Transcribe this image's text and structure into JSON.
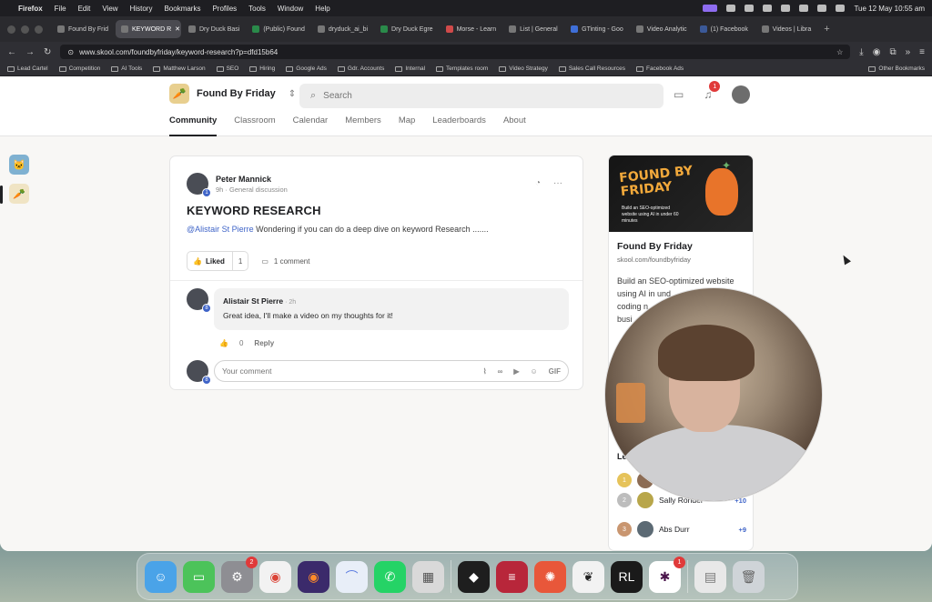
{
  "menubar": {
    "app": "Firefox",
    "items": [
      "File",
      "Edit",
      "View",
      "History",
      "Bookmarks",
      "Profiles",
      "Tools",
      "Window",
      "Help"
    ],
    "datetime": "Tue 12 May 10:55 am"
  },
  "tabs": [
    {
      "label": "Found By Frid"
    },
    {
      "label": "KEYWORD R",
      "active": true
    },
    {
      "label": "Dry Duck Basi"
    },
    {
      "label": "(Public) Found"
    },
    {
      "label": "dryduck_ai_bi"
    },
    {
      "label": "Dry Duck Egre"
    },
    {
      "label": "Morse - Learn"
    },
    {
      "label": "List | General"
    },
    {
      "label": "GTinting - Goo"
    },
    {
      "label": "Video Analytic"
    },
    {
      "label": "(1) Facebook"
    },
    {
      "label": "Videos | Libra"
    }
  ],
  "url": "www.skool.com/foundbyfriday/keyword-research?p=dfd15b64",
  "bookmarks": [
    "Lead Cartel",
    "Competition",
    "AI Tools",
    "Matthew Larson",
    "SEO",
    "Hiring",
    "Google Ads",
    "Gdr. Accounts",
    "Internal",
    "Templates room",
    "Video Strategy",
    "Sales Call Resources",
    "Facebook Ads",
    "Other Bookmarks"
  ],
  "skool": {
    "group_name": "Found By Friday",
    "search_placeholder": "Search",
    "notification_count": "1",
    "nav": [
      "Community",
      "Classroom",
      "Calendar",
      "Members",
      "Map",
      "Leaderboards",
      "About"
    ],
    "active_nav": "Community"
  },
  "post": {
    "author": "Peter Mannick",
    "author_level": "1",
    "meta": "9h · General discussion",
    "title": "KEYWORD RESEARCH",
    "mention": "@Alistair St Pierre",
    "body": " Wondering if you can do a deep dive on keyword Research .......",
    "like_label": "Liked",
    "like_count": "1",
    "comment_count": "1 comment"
  },
  "comment": {
    "author": "Alistair St Pierre",
    "author_level": "8",
    "time": " · 2h",
    "text": "Great idea, I'll make a video on my thoughts for it!",
    "likes": "0",
    "reply": "Reply",
    "input_placeholder": "Your comment",
    "gif_label": "GIF"
  },
  "sidebar": {
    "banner_title_1": "FOUND BY",
    "banner_title_2": "FRIDAY",
    "banner_sub": "Build an SEO-optimized website using AI in under 60 minutes",
    "name": "Found By Friday",
    "url": "skool.com/foundbyfriday",
    "desc": "Build an SEO-optimized website using AI in und",
    "desc2": "coding n",
    "desc3": "busi",
    "leaderboard_title": "Lea",
    "leaderboard": [
      {
        "rank": "1",
        "name": "",
        "points": ""
      },
      {
        "rank": "2",
        "name": "Sally Rondel",
        "points": "+10"
      },
      {
        "rank": "3",
        "name": "Abs Durr",
        "points": "+9"
      }
    ]
  },
  "dock": {
    "badges": {
      "settings": "2",
      "slack": "1"
    }
  }
}
